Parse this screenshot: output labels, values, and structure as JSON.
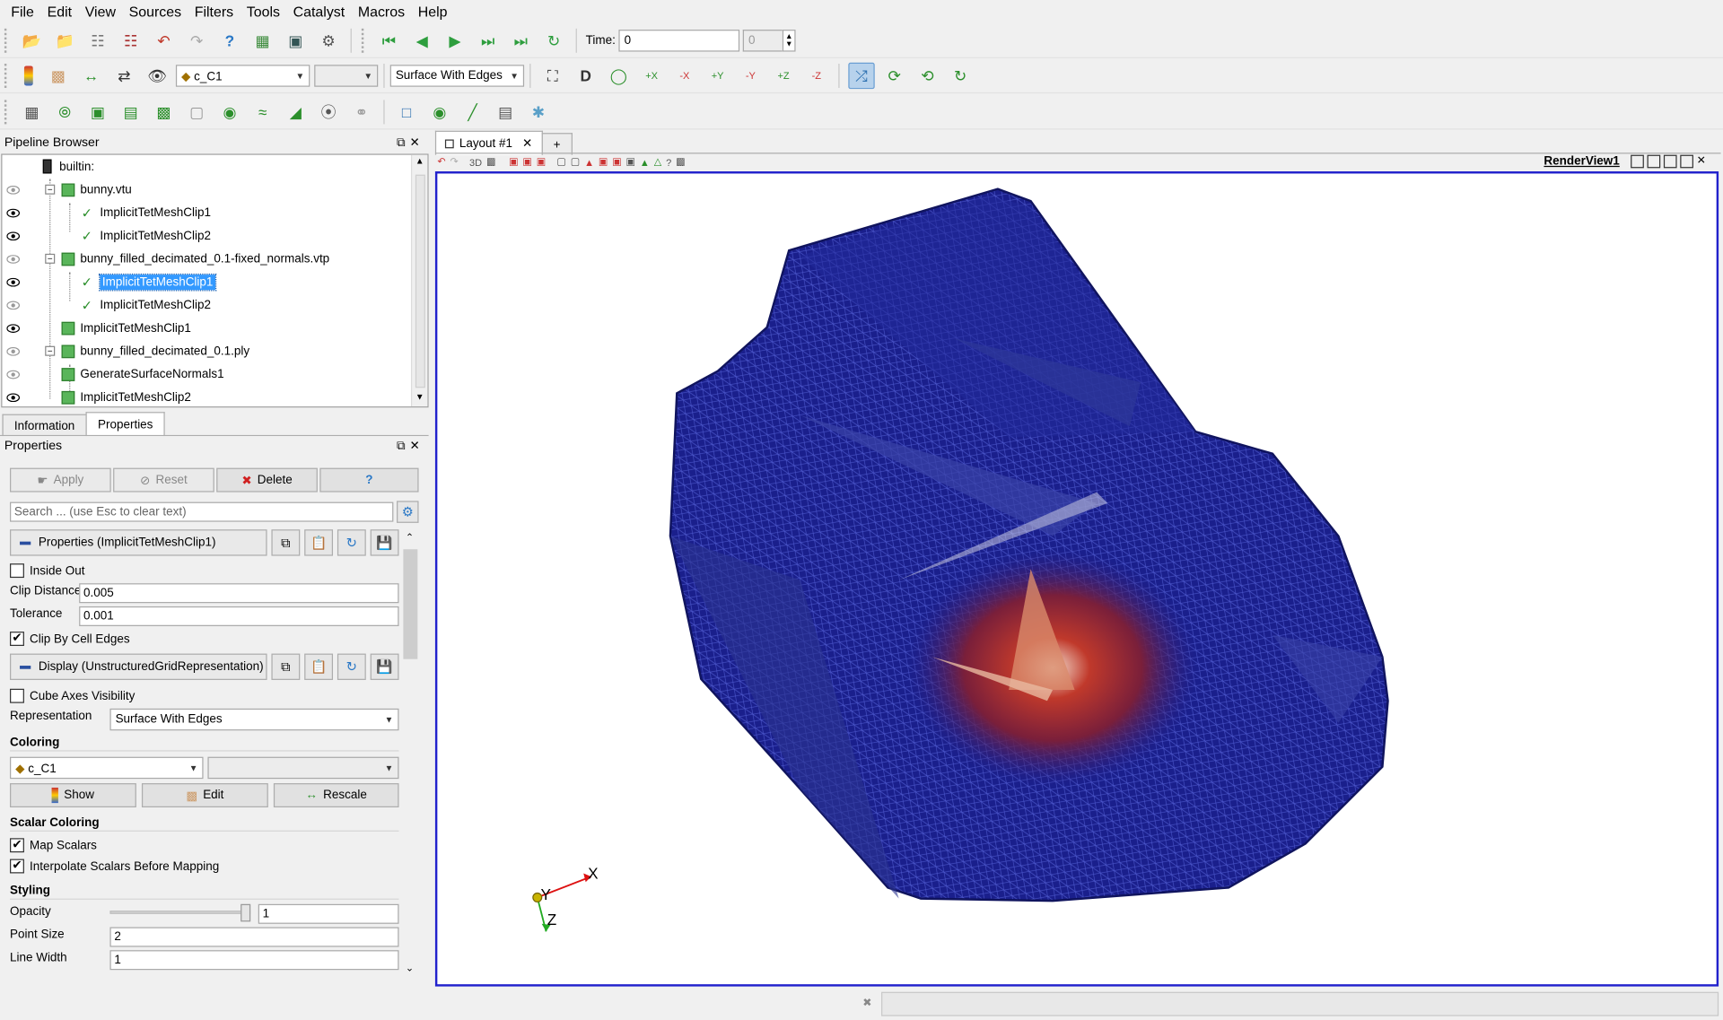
{
  "menu": [
    "File",
    "Edit",
    "View",
    "Sources",
    "Filters",
    "Tools",
    "Catalyst",
    "Macros",
    "Help"
  ],
  "toolbar": {
    "time_label": "Time:",
    "time_value": "0",
    "time_step": "0",
    "array_combo": "c_C1",
    "representation_combo": "Surface With Edges",
    "view_axis_buttons": [
      "+X",
      "-X",
      "+Y",
      "-Y",
      "+Z",
      "-Z"
    ]
  },
  "pipeline": {
    "title": "Pipeline Browser",
    "items": [
      {
        "label": "builtin:",
        "level": 0
      },
      {
        "label": "bunny.vtu",
        "level": 1
      },
      {
        "label": "ImplicitTetMeshClip1",
        "level": 2
      },
      {
        "label": "ImplicitTetMeshClip2",
        "level": 2
      },
      {
        "label": "bunny_filled_decimated_0.1-fixed_normals.vtp",
        "level": 1
      },
      {
        "label": "ImplicitTetMeshClip1",
        "level": 2,
        "selected": true
      },
      {
        "label": "ImplicitTetMeshClip2",
        "level": 2
      },
      {
        "label": "ImplicitTetMeshClip1",
        "level": 1
      },
      {
        "label": "bunny_filled_decimated_0.1.ply",
        "level": 1
      },
      {
        "label": "GenerateSurfaceNormals1",
        "level": 1
      },
      {
        "label": "ImplicitTetMeshClip2",
        "level": 1
      }
    ]
  },
  "tabs": {
    "information": "Information",
    "properties": "Properties"
  },
  "properties": {
    "title": "Properties",
    "apply": "Apply",
    "reset": "Reset",
    "delete": "Delete",
    "help": "?",
    "search_placeholder": "Search ... (use Esc to clear text)",
    "section_properties": "Properties (ImplicitTetMeshClip1)",
    "inside_out": "Inside Out",
    "clip_distance_label": "Clip Distance",
    "clip_distance": "0.005",
    "tolerance_label": "Tolerance",
    "tolerance": "0.001",
    "clip_by_cell_edges": "Clip By Cell Edges",
    "section_display": "Display (UnstructuredGridRepresentation)",
    "cube_axes": "Cube Axes Visibility",
    "representation_label": "Representation",
    "representation": "Surface With Edges",
    "coloring_header": "Coloring",
    "coloring_array": "c_C1",
    "show": "Show",
    "edit": "Edit",
    "rescale": "Rescale",
    "scalar_coloring_header": "Scalar Coloring",
    "map_scalars": "Map Scalars",
    "interpolate_scalars": "Interpolate Scalars Before Mapping",
    "styling_header": "Styling",
    "opacity_label": "Opacity",
    "opacity": "1",
    "opacity_level": 1.0,
    "point_size_label": "Point Size",
    "point_size": "2",
    "line_width_label": "Line Width",
    "line_width": "1"
  },
  "layout": {
    "tab_label": "Layout #1",
    "add_tab": "+",
    "view_title": "RenderView1",
    "view_3d_label": "3D"
  },
  "axes": {
    "x": "X",
    "y": "Y",
    "z": "Z"
  },
  "colors": {
    "accent_selection": "#3399ff",
    "view_border": "#2222cc",
    "mesh_blue": "#1a1f8c",
    "mesh_red": "#b22222"
  }
}
